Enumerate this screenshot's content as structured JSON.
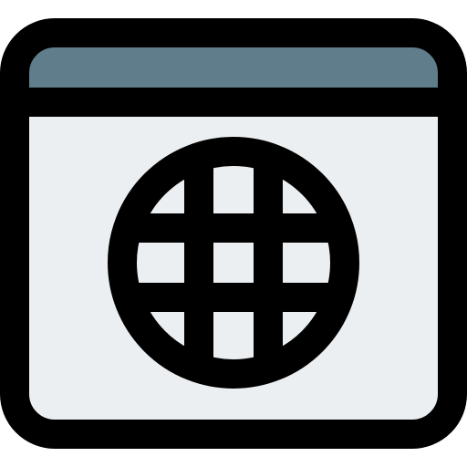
{
  "icon": {
    "name": "browser-globe-icon",
    "colors": {
      "outline": "#000000",
      "title_bar": "#607d8b",
      "window_body": "#eceff1",
      "background": "#ffffff"
    }
  }
}
